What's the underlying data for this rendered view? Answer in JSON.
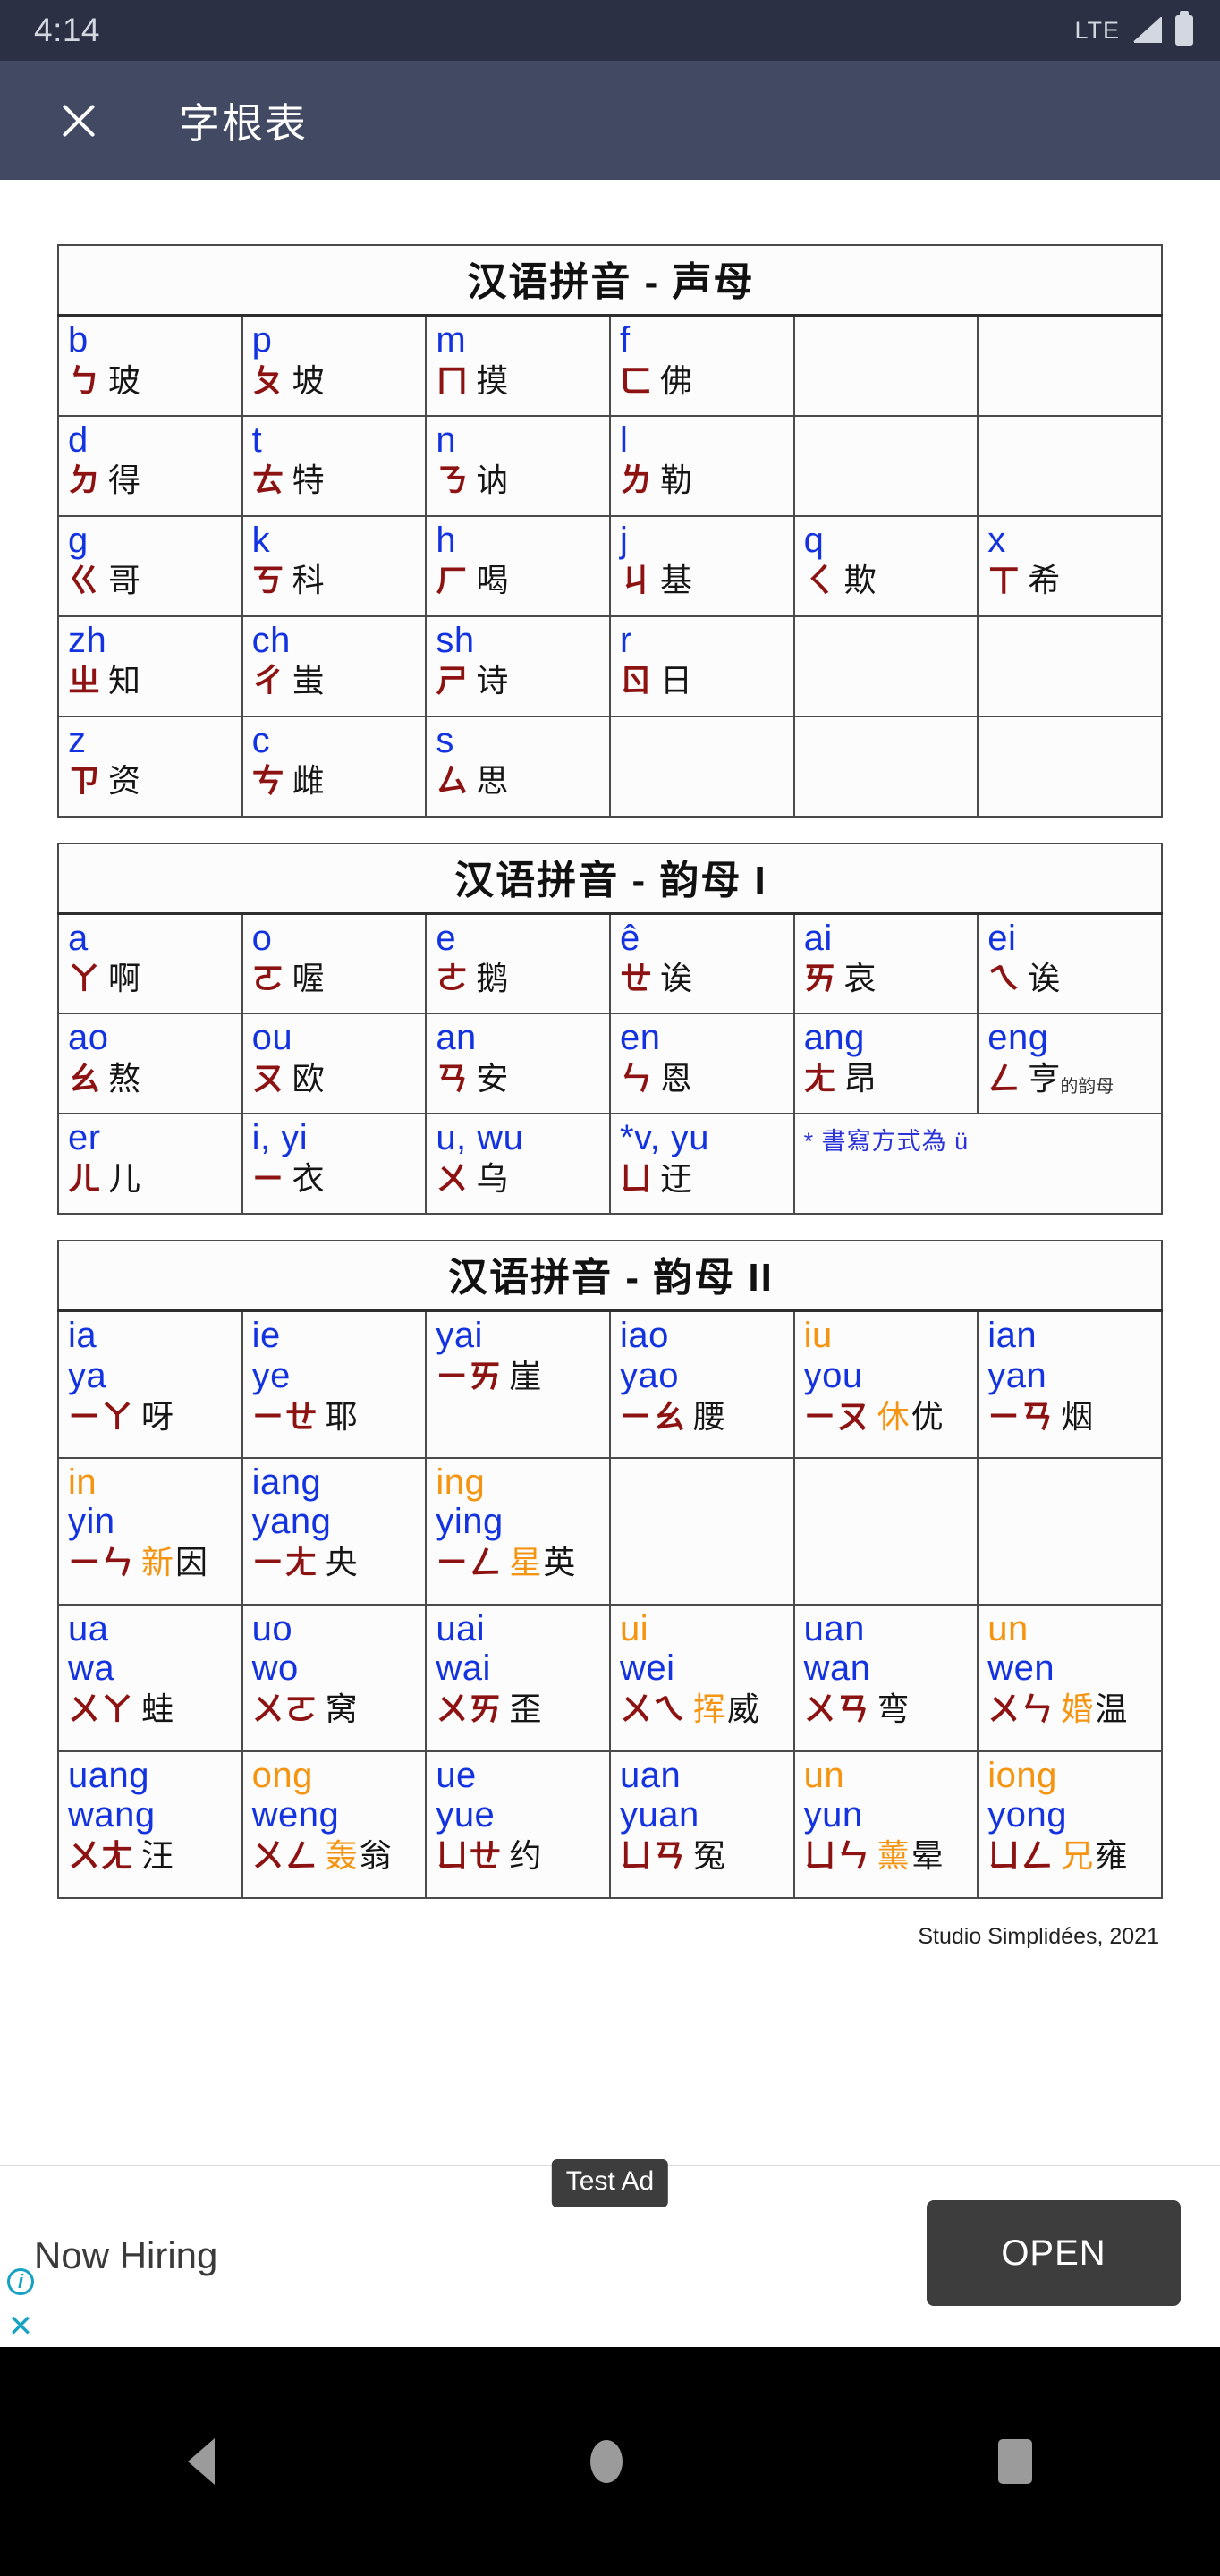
{
  "statusbar": {
    "clock": "4:14",
    "network": "LTE"
  },
  "appbar": {
    "title": "字根表",
    "close_icon": "close-icon"
  },
  "tables": [
    {
      "caption": "汉语拼音 - 声母",
      "rows": [
        [
          {
            "py": "b",
            "zh": "ㄅ",
            "ex": "玻"
          },
          {
            "py": "p",
            "zh": "ㄆ",
            "ex": "坡"
          },
          {
            "py": "m",
            "zh": "ㄇ",
            "ex": "摸"
          },
          {
            "py": "f",
            "zh": "ㄈ",
            "ex": "佛"
          },
          {
            "empty": true
          },
          {
            "empty": true
          }
        ],
        [
          {
            "py": "d",
            "zh": "ㄉ",
            "ex": "得"
          },
          {
            "py": "t",
            "zh": "ㄊ",
            "ex": "特"
          },
          {
            "py": "n",
            "zh": "ㄋ",
            "ex": "讷"
          },
          {
            "py": "l",
            "zh": "ㄌ",
            "ex": "勒"
          },
          {
            "empty": true
          },
          {
            "empty": true
          }
        ],
        [
          {
            "py": "g",
            "zh": "ㄍ",
            "ex": "哥"
          },
          {
            "py": "k",
            "zh": "ㄎ",
            "ex": "科"
          },
          {
            "py": "h",
            "zh": "ㄏ",
            "ex": "喝"
          },
          {
            "py": "j",
            "zh": "ㄐ",
            "ex": "基"
          },
          {
            "py": "q",
            "zh": "ㄑ",
            "ex": "欺"
          },
          {
            "py": "x",
            "zh": "ㄒ",
            "ex": "希"
          }
        ],
        [
          {
            "py": "zh",
            "zh": "ㄓ",
            "ex": "知"
          },
          {
            "py": "ch",
            "zh": "ㄔ",
            "ex": "蚩"
          },
          {
            "py": "sh",
            "zh": "ㄕ",
            "ex": "诗"
          },
          {
            "py": "r",
            "zh": "ㄖ",
            "ex": "日"
          },
          {
            "empty": true
          },
          {
            "empty": true
          }
        ],
        [
          {
            "py": "z",
            "zh": "ㄗ",
            "ex": "资"
          },
          {
            "py": "c",
            "zh": "ㄘ",
            "ex": "雌"
          },
          {
            "py": "s",
            "zh": "ㄙ",
            "ex": "思"
          },
          {
            "empty": true
          },
          {
            "empty": true
          },
          {
            "empty": true
          }
        ]
      ]
    },
    {
      "caption": "汉语拼音 - 韵母 I",
      "rows": [
        [
          {
            "py": "a",
            "zh": "ㄚ",
            "ex": "啊"
          },
          {
            "py": "o",
            "zh": "ㄛ",
            "ex": "喔"
          },
          {
            "py": "e",
            "zh": "ㄜ",
            "ex": "鹅"
          },
          {
            "py": "ê",
            "zh": "ㄝ",
            "ex": "诶"
          },
          {
            "py": "ai",
            "zh": "ㄞ",
            "ex": "哀"
          },
          {
            "py": "ei",
            "zh": "ㄟ",
            "ex": "诶"
          }
        ],
        [
          {
            "py": "ao",
            "zh": "ㄠ",
            "ex": "熬"
          },
          {
            "py": "ou",
            "zh": "ㄡ",
            "ex": "欧"
          },
          {
            "py": "an",
            "zh": "ㄢ",
            "ex": "安"
          },
          {
            "py": "en",
            "zh": "ㄣ",
            "ex": "恩"
          },
          {
            "py": "ang",
            "zh": "ㄤ",
            "ex": "昂"
          },
          {
            "py": "eng",
            "zh": "ㄥ",
            "ex": "亨",
            "suffix": "的韵母"
          }
        ],
        [
          {
            "py": "er",
            "zh": "ㄦ",
            "ex": "儿"
          },
          {
            "py": "i, yi",
            "zh": "ㄧ",
            "ex": "衣"
          },
          {
            "py": "u, wu",
            "zh": "ㄨ",
            "ex": "乌"
          },
          {
            "py": "*v, yu",
            "zh": "ㄩ",
            "ex": "迂"
          },
          {
            "note": "* 書寫方式為 ü",
            "colspan": 2
          }
        ]
      ]
    },
    {
      "caption": "汉语拼音 - 韵母 II",
      "rows": [
        [
          {
            "py": "ia",
            "py2": "ya",
            "zh": "ㄧㄚ",
            "ex": "呀"
          },
          {
            "py": "ie",
            "py2": "ye",
            "zh": "ㄧㄝ",
            "ex": "耶"
          },
          {
            "py": "yai",
            "zh": "ㄧㄞ",
            "ex": "崖"
          },
          {
            "py": "iao",
            "py2": "yao",
            "zh": "ㄧㄠ",
            "ex": "腰"
          },
          {
            "py": "iu",
            "py_orange": true,
            "py2": "you",
            "zh": "ㄧㄡ",
            "ex_orange": "休",
            "ex": "优"
          },
          {
            "py": "ian",
            "py2": "yan",
            "zh": "ㄧㄢ",
            "ex": "烟"
          }
        ],
        [
          {
            "py": "in",
            "py_orange": true,
            "py2": "yin",
            "zh": "ㄧㄣ",
            "ex_orange": "新",
            "ex": "因"
          },
          {
            "py": "iang",
            "py2": "yang",
            "zh": "ㄧㄤ",
            "ex": "央"
          },
          {
            "py": "ing",
            "py_orange": true,
            "py2": "ying",
            "zh": "ㄧㄥ",
            "ex_orange": "星",
            "ex": "英"
          },
          {
            "empty": true
          },
          {
            "empty": true
          },
          {
            "empty": true
          }
        ],
        [
          {
            "py": "ua",
            "py2": "wa",
            "zh": "ㄨㄚ",
            "ex": "蛙"
          },
          {
            "py": "uo",
            "py2": "wo",
            "zh": "ㄨㄛ",
            "ex": "窝"
          },
          {
            "py": "uai",
            "py2": "wai",
            "zh": "ㄨㄞ",
            "ex": "歪"
          },
          {
            "py": "ui",
            "py_orange": true,
            "py2": "wei",
            "zh": "ㄨㄟ",
            "ex_orange": "挥",
            "ex": "威"
          },
          {
            "py": "uan",
            "py2": "wan",
            "zh": "ㄨㄢ",
            "ex": "弯"
          },
          {
            "py": "un",
            "py_orange": true,
            "py2": "wen",
            "zh": "ㄨㄣ",
            "ex_orange": "婚",
            "ex": "温"
          }
        ],
        [
          {
            "py": "uang",
            "py2": "wang",
            "zh": "ㄨㄤ",
            "ex": "汪"
          },
          {
            "py": "ong",
            "py_orange": true,
            "py2": "weng",
            "zh": "ㄨㄥ",
            "ex_orange": "轰",
            "ex": "翁"
          },
          {
            "py": "ue",
            "py2": "yue",
            "zh": "ㄩㄝ",
            "ex": "约"
          },
          {
            "py": "uan",
            "py2": "yuan",
            "zh": "ㄩㄢ",
            "ex": "冤"
          },
          {
            "py": "un",
            "py_orange": true,
            "py2": "yun",
            "zh": "ㄩㄣ",
            "ex_orange": "薰",
            "ex": "晕"
          },
          {
            "py": "iong",
            "py_orange": true,
            "py2": "yong",
            "zh": "ㄩㄥ",
            "ex_orange": "兄",
            "ex": "雍"
          }
        ]
      ]
    }
  ],
  "credit": "Studio Simplidées, 2021",
  "ad": {
    "badge": "Test Ad",
    "headline": "Now Hiring",
    "cta": "OPEN",
    "info_icon": "info-icon",
    "close_icon": "close-icon"
  },
  "navbar": {
    "back": "back-icon",
    "home": "home-icon",
    "recents": "recents-icon"
  },
  "colors": {
    "pinyin_blue": "#1433e0",
    "pinyin_orange": "#f59410",
    "bopomofo_red": "#8d1212",
    "appbar": "#424a63",
    "statusbar": "#2b3044"
  }
}
